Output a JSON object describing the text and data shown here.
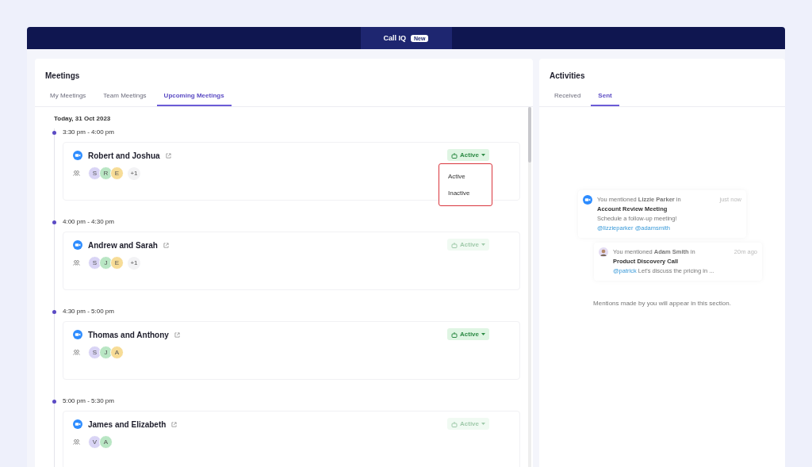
{
  "topbar": {
    "tab": "Call IQ",
    "badge": "New"
  },
  "meetings": {
    "title": "Meetings",
    "tabs": [
      {
        "label": "My Meetings",
        "selected": false
      },
      {
        "label": "Team Meetings",
        "selected": false
      },
      {
        "label": "Upcoming Meetings",
        "selected": true
      }
    ],
    "date": "Today, 31 Oct 2023",
    "slots": [
      {
        "time": "3:30 pm - 4:00 pm",
        "title": "Robert and Joshua",
        "avatars": [
          {
            "initial": "S",
            "color": "#d9d4f5"
          },
          {
            "initial": "R",
            "color": "#b9e6c4"
          },
          {
            "initial": "E",
            "color": "#f7dc96"
          }
        ],
        "more": "+1",
        "status": "Active",
        "disabled": false,
        "expanded": true,
        "options": [
          "Active",
          "Inactive"
        ]
      },
      {
        "time": "4:00 pm - 4:30 pm",
        "title": "Andrew and Sarah",
        "avatars": [
          {
            "initial": "S",
            "color": "#d9d4f5"
          },
          {
            "initial": "J",
            "color": "#b9e6c4"
          },
          {
            "initial": "E",
            "color": "#f7dc96"
          }
        ],
        "more": "+1",
        "status": "Active",
        "disabled": true,
        "expanded": false
      },
      {
        "time": "4:30 pm - 5:00 pm",
        "title": "Thomas and Anthony",
        "avatars": [
          {
            "initial": "S",
            "color": "#d9d4f5"
          },
          {
            "initial": "J",
            "color": "#b9e6c4"
          },
          {
            "initial": "A",
            "color": "#f7dc96"
          }
        ],
        "status": "Active",
        "disabled": false,
        "expanded": false
      },
      {
        "time": "5:00 pm - 5:30 pm",
        "title": "James and Elizabeth",
        "avatars": [
          {
            "initial": "V",
            "color": "#d9d4f5"
          },
          {
            "initial": "A",
            "color": "#b9e6c4"
          }
        ],
        "status": "Active",
        "disabled": true,
        "expanded": false
      }
    ]
  },
  "activities": {
    "title": "Activities",
    "tabs": [
      {
        "label": "Received",
        "selected": false
      },
      {
        "label": "Sent",
        "selected": true
      }
    ],
    "mentions": [
      {
        "kind": "video",
        "line": "You mentioned **Lizzie Parker** in",
        "time": "just now",
        "meeting": "Account Review Meeting",
        "text": "Schedule a follow-up meeting!",
        "tags": "@lizzieparker @adamsmith"
      },
      {
        "kind": "person",
        "line": "You mentioned **Adam Smith** in",
        "time": "20m ago",
        "meeting": "Product Discovery Call",
        "tag": "@patrick",
        "text": "Let's discuss the pricing in ..."
      }
    ],
    "empty": "Mentions made by you will appear in this section."
  }
}
